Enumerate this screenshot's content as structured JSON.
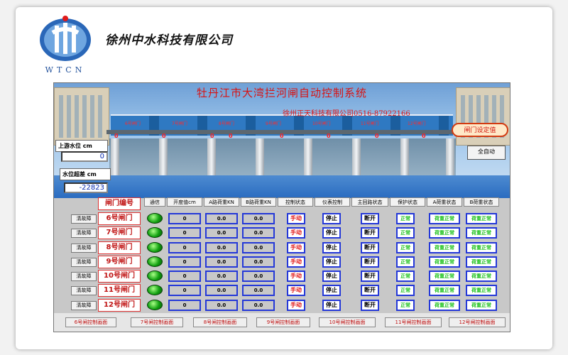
{
  "company": "徐州中水科技有限公司",
  "logo_text": "WTCN",
  "scada": {
    "title": "牡丹江市大湾拦河闸自动控制系统",
    "subtitle": "徐州正天科技有限公司0516-87922166",
    "gate_labels": [
      "6号闸门",
      "7号闸门",
      "8号闸门",
      "9号闸门",
      "10号闸门",
      "11号闸门",
      "12号闸门"
    ],
    "gate_opening_values": [
      "0",
      "0",
      "0",
      "0",
      "0",
      "0",
      "0",
      "0"
    ],
    "upstream_label": "上游水位  cm",
    "upstream_value": "0",
    "overlimit_label": "水位超差  cm",
    "overlimit_value": "-22823",
    "set_button": "闸门设定值",
    "auto_button": "全自动",
    "headers": {
      "gate": "闸门编号",
      "comm": "通信",
      "opening": "开度值cm",
      "loadA": "A路荷重KN",
      "loadB": "B路荷重KN",
      "control": "控制状态",
      "meter": "仪表控制",
      "main_circuit": "主回路状态",
      "protect": "保护状态",
      "a_state": "A荷重状态",
      "b_state": "B荷重状态"
    },
    "rows": [
      {
        "clear": "清故障",
        "name": "6号闸门",
        "opening": "0",
        "a": "0.0",
        "b": "0.0",
        "control": "手动",
        "meter": "停止",
        "main": "断开",
        "protect": "正常",
        "a_state": "荷重正常",
        "b_state": "荷重正常"
      },
      {
        "clear": "清故障",
        "name": "7号闸门",
        "opening": "0",
        "a": "0.0",
        "b": "0.0",
        "control": "手动",
        "meter": "停止",
        "main": "断开",
        "protect": "正常",
        "a_state": "荷重正常",
        "b_state": "荷重正常"
      },
      {
        "clear": "清故障",
        "name": "8号闸门",
        "opening": "0",
        "a": "0.0",
        "b": "0.0",
        "control": "手动",
        "meter": "停止",
        "main": "断开",
        "protect": "正常",
        "a_state": "荷重正常",
        "b_state": "荷重正常"
      },
      {
        "clear": "清故障",
        "name": "9号闸门",
        "opening": "0",
        "a": "0.0",
        "b": "0.0",
        "control": "手动",
        "meter": "停止",
        "main": "断开",
        "protect": "正常",
        "a_state": "荷重正常",
        "b_state": "荷重正常"
      },
      {
        "clear": "清故障",
        "name": "10号闸门",
        "opening": "0",
        "a": "0.0",
        "b": "0.0",
        "control": "手动",
        "meter": "停止",
        "main": "断开",
        "protect": "正常",
        "a_state": "荷重正常",
        "b_state": "荷重正常"
      },
      {
        "clear": "清故障",
        "name": "11号闸门",
        "opening": "0",
        "a": "0.0",
        "b": "0.0",
        "control": "手动",
        "meter": "停止",
        "main": "断开",
        "protect": "正常",
        "a_state": "荷重正常",
        "b_state": "荷重正常"
      },
      {
        "clear": "清故障",
        "name": "12号闸门",
        "opening": "0",
        "a": "0.0",
        "b": "0.0",
        "control": "手动",
        "meter": "停止",
        "main": "断开",
        "protect": "正常",
        "a_state": "荷重正常",
        "b_state": "荷重正常"
      }
    ],
    "nav_buttons": [
      "6号闸控制画面",
      "7号闸控制画面",
      "8号闸控制画面",
      "9号闸控制画面",
      "10号闸控制画面",
      "11号闸控制画面",
      "12号闸控制画面"
    ]
  },
  "colors": {
    "title_red": "#d81313",
    "status_green": "#17c017",
    "border_blue": "#2438d8"
  }
}
